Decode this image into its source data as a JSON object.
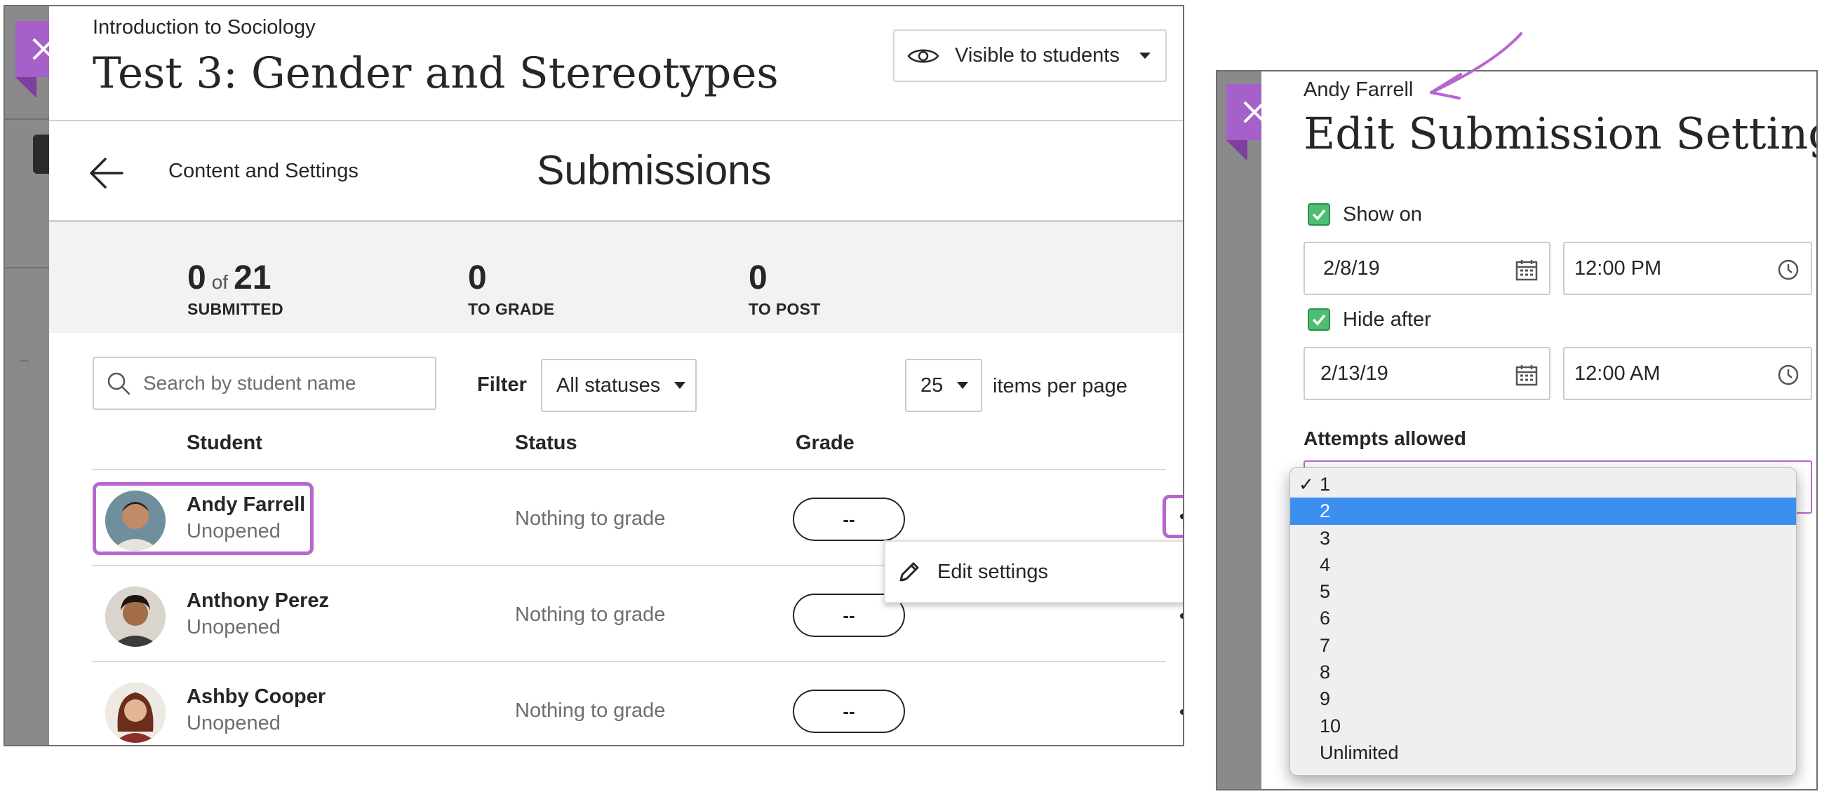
{
  "left": {
    "course_name": "Introduction to Sociology",
    "test_title": "Test 3: Gender and Stereotypes",
    "visibility": {
      "label": "Visible to students",
      "icon": "eye-icon"
    },
    "nav": {
      "back_icon": "back-arrow-icon",
      "back_label": "Content and Settings",
      "page_title": "Submissions"
    },
    "stats": [
      {
        "value": "0",
        "of_word": "of",
        "total": "21",
        "label": "SUBMITTED"
      },
      {
        "value": "0",
        "label": "TO GRADE"
      },
      {
        "value": "0",
        "label": "TO POST"
      }
    ],
    "search": {
      "placeholder": "Search by student name",
      "value": ""
    },
    "filter": {
      "label": "Filter",
      "selected": "All statuses"
    },
    "pagination": {
      "per_page": "25",
      "label": "items per page"
    },
    "columns": {
      "student": "Student",
      "status": "Status",
      "grade": "Grade"
    },
    "rows": [
      {
        "name": "Andy Farrell",
        "submission": "Unopened",
        "status": "Nothing to grade",
        "grade": "--"
      },
      {
        "name": "Anthony Perez",
        "submission": "Unopened",
        "status": "Nothing to grade",
        "grade": "--"
      },
      {
        "name": "Ashby Cooper",
        "submission": "Unopened",
        "status": "Nothing to grade",
        "grade": "--"
      }
    ],
    "menu": {
      "edit_settings": "Edit settings",
      "icon": "pencil-icon"
    }
  },
  "right": {
    "student_name": "Andy Farrell",
    "title": "Edit Submission Settings",
    "show_on": {
      "label": "Show on",
      "checked": true,
      "date": "2/8/19",
      "time": "12:00 PM"
    },
    "hide_after": {
      "label": "Hide after",
      "checked": true,
      "date": "2/13/19",
      "time": "12:00 AM"
    },
    "attempts": {
      "label": "Attempts allowed",
      "checked_option": "1",
      "highlighted_option": "2",
      "options": [
        "1",
        "2",
        "3",
        "4",
        "5",
        "6",
        "7",
        "8",
        "9",
        "10",
        "Unlimited"
      ]
    }
  },
  "colors": {
    "accent_purple": "#a660c9",
    "highlight_purple": "#b766cf",
    "checkbox_green": "#4cbf72",
    "select_blue": "#3d8fef"
  }
}
